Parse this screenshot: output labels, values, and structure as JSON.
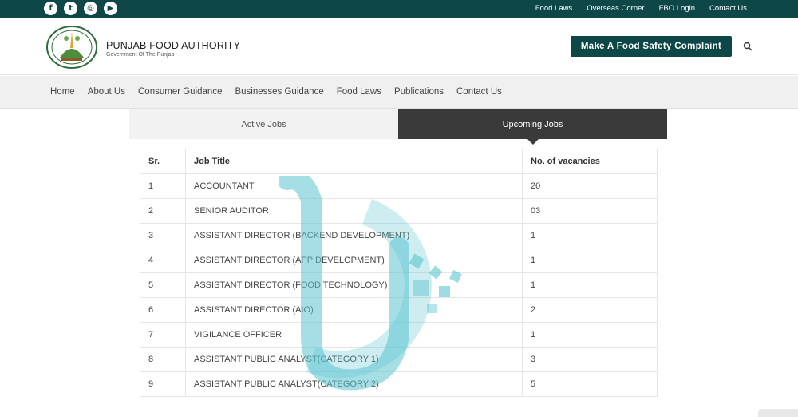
{
  "topbar": {
    "social": [
      {
        "icon": "facebook-icon",
        "glyph": "f"
      },
      {
        "icon": "twitter-icon",
        "glyph": "t"
      },
      {
        "icon": "instagram-icon",
        "glyph": "◎"
      },
      {
        "icon": "youtube-icon",
        "glyph": "▶"
      }
    ],
    "links": [
      "Food Laws",
      "Overseas Corner",
      "FBO Login",
      "Contact Us"
    ]
  },
  "header": {
    "brand_name": "PUNJAB FOOD AUTHORITY",
    "brand_sub": "Government Of The Punjab",
    "complaint_button": "Make A Food Safety Complaint"
  },
  "nav": {
    "items": [
      "Home",
      "About Us",
      "Consumer Guidance",
      "Businesses Guidance",
      "Food Laws",
      "Publications",
      "Contact Us"
    ]
  },
  "tabs": {
    "active_jobs": "Active Jobs",
    "upcoming_jobs": "Upcoming Jobs"
  },
  "table": {
    "headers": [
      "Sr.",
      "Job Title",
      "No. of vacancies"
    ],
    "rows": [
      [
        "1",
        "ACCOUNTANT",
        "20"
      ],
      [
        "2",
        "SENIOR AUDITOR",
        "03"
      ],
      [
        "3",
        "ASSISTANT DIRECTOR (BACKEND DEVELOPMENT)",
        "1"
      ],
      [
        "4",
        "ASSISTANT DIRECTOR (APP DEVELOPMENT)",
        "1"
      ],
      [
        "5",
        "ASSISTANT DIRECTOR (FOOD TECHNOLOGY)",
        "1"
      ],
      [
        "6",
        "ASSISTANT DIRECTOR (AIO)",
        "2"
      ],
      [
        "7",
        "VIGILANCE OFFICER",
        "1"
      ],
      [
        "8",
        "ASSISTANT PUBLIC ANALYST(CATEGORY 1)",
        "3"
      ],
      [
        "9",
        "ASSISTANT PUBLIC ANALYST(CATEGORY 2)",
        "5"
      ]
    ]
  },
  "colors": {
    "brand": "#0d4748",
    "tab_active": "#3a3a3a",
    "watermark": "#5bc4cf"
  }
}
